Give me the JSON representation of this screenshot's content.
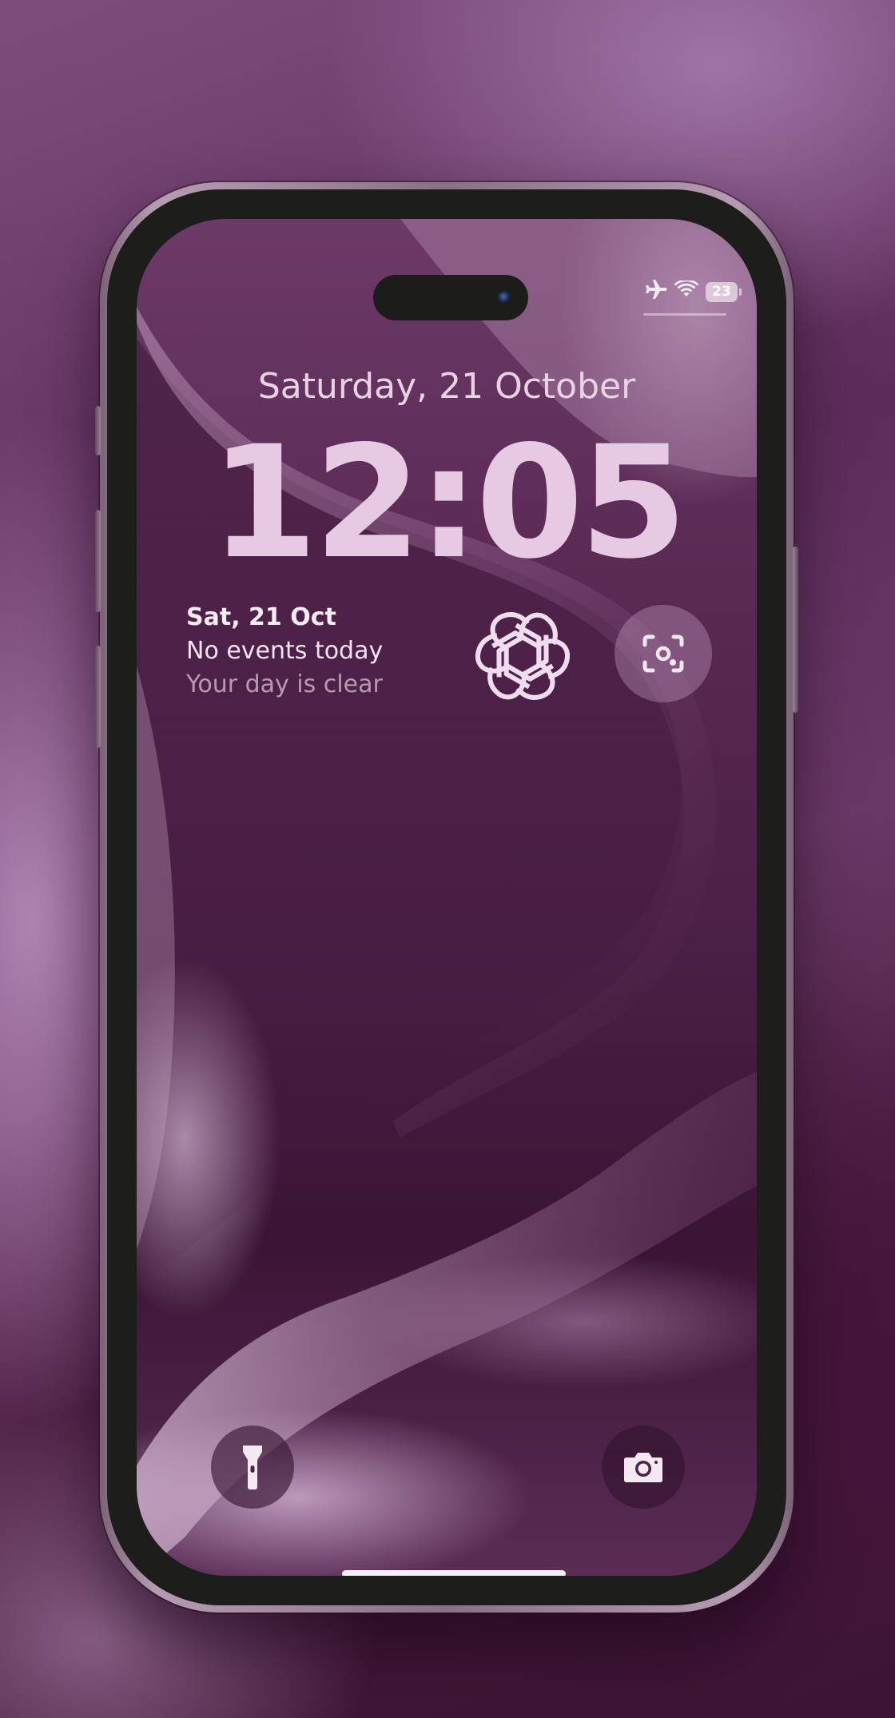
{
  "status_bar": {
    "airplane_icon": "airplane-icon",
    "wifi_icon": "wifi-icon",
    "battery_level": "23"
  },
  "lock_screen": {
    "date": "Saturday, 21 October",
    "time": "12:05"
  },
  "calendar_widget": {
    "date": "Sat, 21 Oct",
    "line1": "No events today",
    "line2": "Your day is clear"
  },
  "widgets": {
    "app_icon": "openai-logo-icon",
    "lens_icon": "visual-lookup-icon"
  },
  "quick_actions": {
    "left_icon": "flashlight-icon",
    "right_icon": "camera-icon"
  },
  "colors": {
    "accent_text": "#e6c9e3",
    "wallpaper_base": "#5b2a55"
  }
}
